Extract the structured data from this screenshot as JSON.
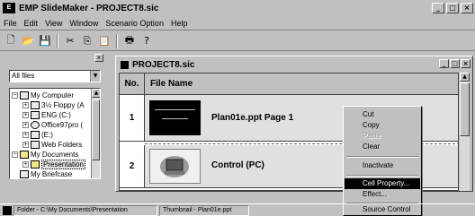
{
  "app": {
    "title": "EMP SlideMaker - PROJECT8.sic",
    "logo_text": "E"
  },
  "window_buttons": {
    "minimize": "_",
    "maximize": "□",
    "close": "×"
  },
  "menu": [
    "File",
    "Edit",
    "View",
    "Window",
    "Scenario Option",
    "Help"
  ],
  "toolbar": [
    {
      "name": "new-icon",
      "glyph": "🗋"
    },
    {
      "name": "open-icon",
      "glyph": "📂"
    },
    {
      "name": "save-icon",
      "glyph": "💾"
    },
    {
      "name": "cut-icon",
      "glyph": "✂"
    },
    {
      "name": "copy-icon",
      "glyph": "⎘"
    },
    {
      "name": "paste-icon",
      "glyph": "📋"
    },
    {
      "name": "print-icon",
      "glyph": "🖶"
    },
    {
      "name": "help-icon",
      "glyph": "?"
    }
  ],
  "leftpane": {
    "close_glyph": "×",
    "filter_value": "All files",
    "tree": [
      "My Computer",
      "3½ Floppy (A",
      "ENG (C:)",
      "Office97pro (",
      "(E:)",
      "Web Folders",
      "My Documents",
      "Presentation",
      "My Briefcase"
    ]
  },
  "document": {
    "title": "PROJECT8.sic",
    "col_no": "No.",
    "col_name": "File Name",
    "rows": [
      {
        "no": "1",
        "name": "Plan01e.ppt   Page 1"
      },
      {
        "no": "2",
        "name": "Control   (PC)"
      }
    ]
  },
  "context_menu": {
    "items": [
      {
        "label": "Cut",
        "disabled": false
      },
      {
        "label": "Copy",
        "disabled": false
      },
      {
        "label": "Paste",
        "disabled": true
      },
      {
        "label": "Clear",
        "disabled": false
      },
      {
        "label": "Inactivate",
        "disabled": false
      },
      {
        "label": "Cell Property...",
        "disabled": false
      },
      {
        "label": "Effect...",
        "disabled": false
      },
      {
        "label": "Source Control",
        "disabled": false
      }
    ],
    "highlighted": "Cell Property..."
  },
  "statusbar": {
    "folder": "Folder - C:\\My Documents\\Presentation",
    "thumbnail": "Thumbnail - Plan01e.ppt"
  }
}
